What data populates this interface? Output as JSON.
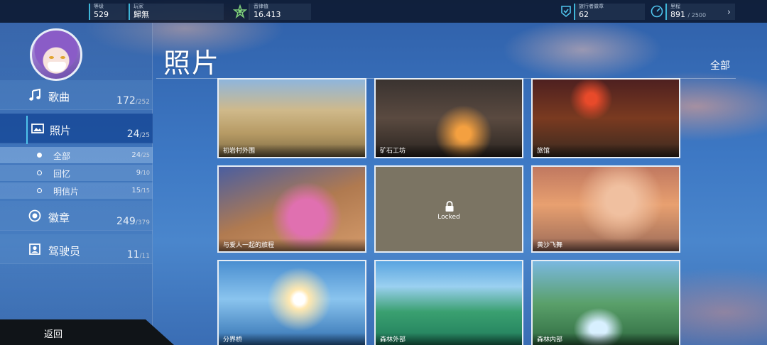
{
  "topbar": {
    "level": {
      "label": "等级",
      "value": "529"
    },
    "player": {
      "label": "玩家",
      "value": "歸無"
    },
    "melody": {
      "label": "音律值",
      "value": "16.413"
    },
    "badges": {
      "label": "旅行者徽章",
      "value": "62"
    },
    "mileage": {
      "label": "里程",
      "value": "891",
      "total": "/ 2500"
    }
  },
  "sidebar": {
    "songs": {
      "label": "歌曲",
      "count": "172",
      "total": "/252"
    },
    "photos": {
      "label": "照片",
      "count": "24",
      "total": "/25"
    },
    "sub": [
      {
        "label": "全部",
        "count": "24",
        "total": "/25"
      },
      {
        "label": "回忆",
        "count": "9",
        "total": "/10"
      },
      {
        "label": "明信片",
        "count": "15",
        "total": "/15"
      }
    ],
    "badges": {
      "label": "徽章",
      "count": "249",
      "total": "/379"
    },
    "pilots": {
      "label": "驾驶员",
      "count": "11",
      "total": "/11"
    },
    "back_label": "返回"
  },
  "main": {
    "title": "照片",
    "filter": "全部",
    "photos": [
      {
        "caption": "初岩村外围"
      },
      {
        "caption": "矿石工坊"
      },
      {
        "caption": "旅馆"
      },
      {
        "caption": "与爱人一起的旅程"
      },
      {
        "caption": "Locked"
      },
      {
        "caption": "黄沙飞舞"
      },
      {
        "caption": "分界桥"
      },
      {
        "caption": "森林外部"
      },
      {
        "caption": "森林内部"
      }
    ]
  },
  "colors": {
    "accent": "#4fc3ec",
    "active_nav": "#1446a0",
    "topbar": "#0a1224"
  }
}
